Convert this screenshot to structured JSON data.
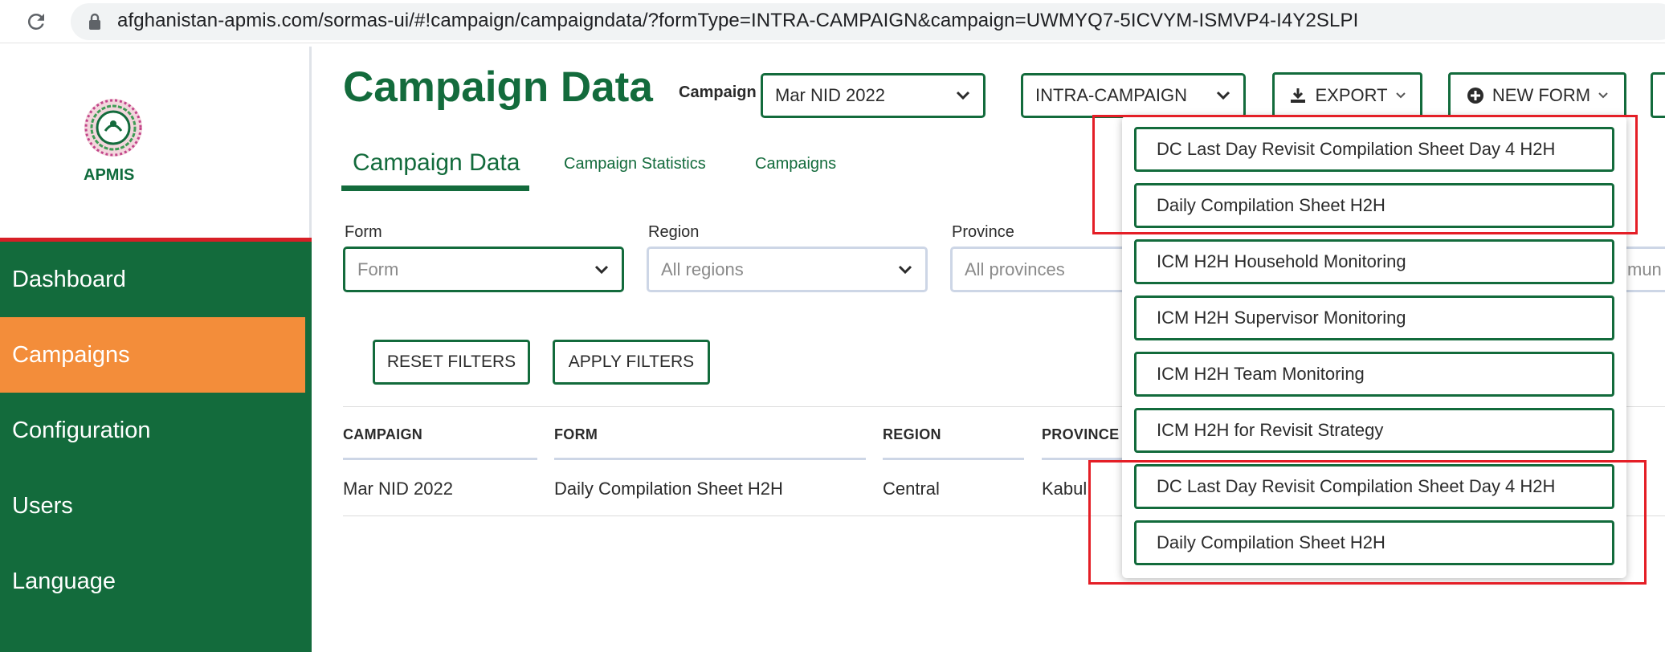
{
  "browser": {
    "url": "afghanistan-apmis.com/sormas-ui/#!campaign/campaigndata/?formType=INTRA-CAMPAIGN&campaign=UWMYQ7-5ICVYM-ISMVP4-I4Y2SLPI"
  },
  "sidebar": {
    "logo_text": "APMIS",
    "items": [
      {
        "label": "Dashboard"
      },
      {
        "label": "Campaigns",
        "active": true
      },
      {
        "label": "Configuration"
      },
      {
        "label": "Users"
      },
      {
        "label": "Language"
      }
    ]
  },
  "header": {
    "title": "Campaign Data",
    "campaign_label": "Campaign",
    "campaign_value": "Mar NID 2022",
    "form_type_value": "INTRA-CAMPAIGN",
    "export_label": "EXPORT",
    "new_form_label": "NEW FORM"
  },
  "tabs": [
    {
      "label": "Campaign Data",
      "active": true
    },
    {
      "label": "Campaign Statistics"
    },
    {
      "label": "Campaigns"
    }
  ],
  "filters": {
    "form": {
      "label": "Form",
      "placeholder": "Form"
    },
    "region": {
      "label": "Region",
      "placeholder": "All regions"
    },
    "province": {
      "label": "Province",
      "placeholder": "All provinces"
    },
    "community_peek": "mun",
    "reset_label": "RESET FILTERS",
    "apply_label": "APPLY FILTERS"
  },
  "table": {
    "headers": [
      "CAMPAIGN",
      "FORM",
      "REGION",
      "PROVINCE"
    ],
    "rows": [
      [
        "Mar NID 2022",
        "Daily Compilation Sheet H2H",
        "Central",
        "Kabul"
      ]
    ],
    "row_peek": "2"
  },
  "new_form_menu": {
    "items": [
      {
        "label": "DC Last Day Revisit Compilation Sheet Day 4 H2H"
      },
      {
        "label": "Daily Compilation Sheet H2H"
      },
      {
        "label": "ICM H2H Household Monitoring"
      },
      {
        "label": "ICM H2H Supervisor Monitoring"
      },
      {
        "label": "ICM H2H Team Monitoring"
      },
      {
        "label": "ICM H2H for Revisit Strategy"
      },
      {
        "label": "DC Last Day Revisit Compilation Sheet Day 4 H2H"
      },
      {
        "label": "Daily Compilation Sheet H2H"
      }
    ]
  },
  "colors": {
    "brand_green": "#136b3c",
    "active_orange": "#f38d3a",
    "highlight_red": "#e41e26"
  }
}
